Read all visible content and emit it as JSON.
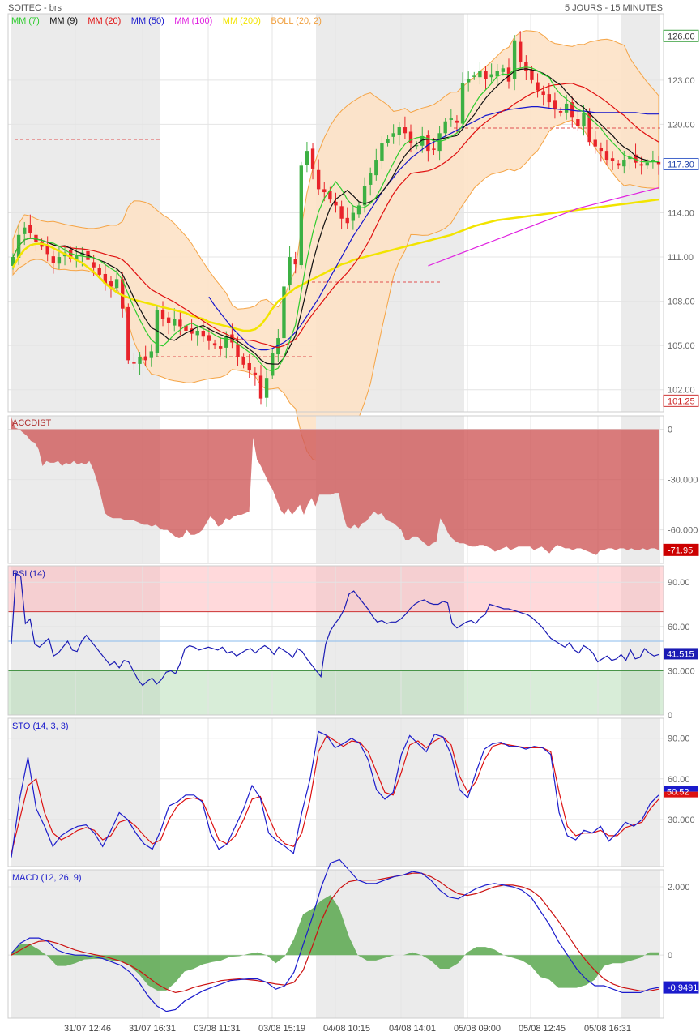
{
  "header": {
    "title": "SOITEC - brs",
    "period": "5 JOURS - 15 MINUTES"
  },
  "colors": {
    "shade": "#ebebeb",
    "grid": "#e4e4e4",
    "frame": "#cccccc",
    "up": "#3cb043",
    "down": "#e8232a",
    "boll_fill": "#fde2c6",
    "boll_line": "#f5a445",
    "accdist_fill": "#d05a5a",
    "rsi_line": "#1b1bb4",
    "stoK": "#1b1bcc",
    "stoD": "#dd1111",
    "macd_line": "#1b1bcc",
    "signal_line": "#cc1111",
    "hist_fill": "#5aa84f"
  },
  "chart_data": [
    {
      "panel": "price",
      "type": "candlestick",
      "legend": [
        {
          "label": "MM (7)",
          "color": "#2ecc2e"
        },
        {
          "label": "MM (9)",
          "color": "#111111"
        },
        {
          "label": "MM (20)",
          "color": "#e01010"
        },
        {
          "label": "MM (50)",
          "color": "#1515cc"
        },
        {
          "label": "MM (100)",
          "color": "#e020e0"
        },
        {
          "label": "MM (200)",
          "color": "#f2e400"
        },
        {
          "label": "BOLL (20, 2)",
          "color": "#f0a040"
        }
      ],
      "ylim": [
        100.5,
        127.5
      ],
      "yticks": [
        "126.00",
        "123.00",
        "120.00",
        "117.30",
        "114.00",
        "111.00",
        "108.00",
        "105.00",
        "102.00",
        "101.25"
      ],
      "ytick_values": [
        126,
        123,
        120,
        117.3,
        114,
        111,
        108,
        105,
        102,
        101.25
      ],
      "last_price": "117.30",
      "high_marker": "126.00",
      "low_marker": "101.25",
      "close": [
        111.0,
        112.5,
        113.0,
        112.6,
        112.0,
        111.7,
        111.2,
        110.6,
        111.0,
        111.3,
        110.9,
        111.1,
        111.3,
        110.8,
        110.3,
        109.8,
        109.2,
        109.0,
        109.5,
        107.5,
        104.0,
        103.8,
        104.2,
        104.0,
        104.6,
        107.4,
        106.8,
        106.5,
        106.8,
        106.3,
        106.0,
        105.8,
        106.0,
        105.6,
        105.3,
        105.0,
        104.8,
        105.6,
        105.2,
        104.2,
        103.7,
        103.3,
        103.0,
        101.4,
        102.8,
        104.5,
        105.5,
        109.0,
        111.0,
        110.5,
        117.2,
        118.2,
        117.0,
        115.6,
        115.4,
        114.9,
        114.5,
        113.6,
        113.3,
        114.0,
        114.5,
        115.8,
        116.7,
        117.6,
        118.7,
        119.0,
        119.4,
        119.8,
        119.4,
        118.7,
        118.6,
        119.2,
        118.2,
        118.3,
        119.4,
        120.2,
        120.4,
        120.1,
        122.8,
        123.1,
        123.3,
        123.6,
        123.1,
        123.4,
        123.6,
        123.8,
        122.9,
        125.7,
        124.2,
        123.6,
        123.0,
        122.3,
        122.0,
        121.5,
        121.0,
        120.8,
        121.4,
        120.5,
        119.9,
        120.8,
        118.8,
        118.5,
        118.2,
        117.6,
        117.5,
        117.2,
        117.6,
        117.8,
        117.4,
        117.2,
        117.4,
        117.6,
        117.3
      ],
      "ma200": [
        110.3,
        111.0,
        111.5,
        111.8,
        111.9,
        111.9,
        111.8,
        111.6,
        111.4,
        111.2,
        111.0,
        110.8,
        110.6,
        110.3,
        110.0,
        109.6,
        109.2,
        108.9,
        108.6,
        108.4,
        108.25,
        108.1,
        108.0,
        107.9,
        107.8,
        107.7,
        107.6,
        107.5,
        107.4,
        107.3,
        107.2,
        107.0,
        106.9,
        106.8,
        106.6,
        106.5,
        106.4,
        106.3,
        106.2,
        106.1,
        106.0,
        106.0,
        106.1,
        106.4,
        106.9,
        107.5,
        108.0,
        108.3,
        108.6,
        108.9,
        109.1,
        109.3,
        109.5,
        109.7,
        109.9,
        110.1,
        110.3,
        110.5,
        110.6,
        110.8,
        110.9,
        111.0,
        111.1,
        111.2,
        111.3,
        111.4,
        111.5,
        111.6,
        111.7,
        111.8,
        111.9,
        112.0,
        112.1,
        112.2,
        112.3,
        112.4,
        112.5,
        112.65,
        112.8,
        112.95,
        113.1,
        113.2,
        113.3,
        113.4,
        113.5,
        113.55,
        113.6,
        113.65,
        113.7,
        113.75,
        113.8,
        113.85,
        113.9,
        113.95,
        114.0,
        114.05,
        114.1,
        114.15,
        114.2,
        114.25,
        114.3,
        114.35,
        114.4,
        114.45,
        114.5,
        114.55,
        114.6,
        114.65,
        114.7,
        114.75,
        114.8,
        114.85,
        114.9
      ],
      "ma100_from": 72,
      "ma100": [
        110.4,
        110.55,
        110.7,
        110.85,
        111.0,
        111.15,
        111.3,
        111.45,
        111.6,
        111.75,
        111.9,
        112.05,
        112.2,
        112.35,
        112.5,
        112.65,
        112.8,
        112.95,
        113.1,
        113.25,
        113.4,
        113.55,
        113.7,
        113.85,
        114.0,
        114.15,
        114.3,
        114.4,
        114.5,
        114.6,
        114.7,
        114.8,
        114.9,
        115.0,
        115.1,
        115.2,
        115.3,
        115.4,
        115.5,
        115.6,
        115.7
      ],
      "ma50_from": 34,
      "ma50": [
        108.3,
        107.7,
        107.2,
        106.7,
        106.2,
        105.8,
        105.4,
        105.0,
        104.8,
        104.7,
        104.7,
        104.8,
        105.0,
        105.2,
        105.5,
        105.9,
        106.4,
        107.0,
        107.6,
        108.2,
        108.9,
        109.6,
        110.3,
        111.0,
        111.7,
        112.4,
        113.0,
        113.6,
        114.2,
        114.8,
        115.4,
        115.9,
        116.4,
        116.9,
        117.3,
        117.7,
        118.0,
        118.3,
        118.6,
        118.8,
        119.0,
        119.2,
        119.4,
        119.6,
        119.8,
        120.0,
        120.2,
        120.4,
        120.6,
        120.7,
        120.8,
        120.9,
        121.0,
        121.05,
        121.1,
        121.15,
        121.2,
        121.2,
        121.15,
        121.1,
        121.05,
        121.0,
        121.0,
        120.95,
        120.9,
        120.9,
        120.85,
        120.8,
        120.8,
        120.8,
        120.8,
        120.8,
        120.8,
        120.8,
        120.8,
        120.75,
        120.7,
        120.7,
        120.7
      ]
    },
    {
      "panel": "accdist",
      "type": "area",
      "label": "ACCDIST",
      "ylim": [
        -80,
        8
      ],
      "yticks": [
        "0",
        "-30.000",
        "-60.000",
        "-71.95"
      ],
      "ytick_values": [
        0,
        -30,
        -60,
        -71.95
      ],
      "last_value": "-71.95",
      "values": [
        7,
        1,
        0,
        -2,
        -4,
        -7,
        -8,
        -12,
        -22,
        -19,
        -20,
        -20,
        -19,
        -22,
        -20,
        -21,
        -19,
        -21,
        -20,
        -21,
        -19,
        -24,
        -31,
        -40,
        -50,
        -52,
        -53,
        -53,
        -53,
        -54,
        -54,
        -54,
        -55,
        -56,
        -57,
        -57,
        -58,
        -57,
        -59,
        -60,
        -60,
        -62,
        -64,
        -65,
        -64,
        -60,
        -63,
        -63,
        -62,
        -60,
        -56,
        -52,
        -54,
        -58,
        -57,
        -53,
        -54,
        -52,
        -51,
        -51,
        -50,
        -49,
        -5,
        -18,
        -22,
        -27,
        -32,
        -36,
        -42,
        -48,
        -51,
        -47,
        -51,
        -48,
        -45,
        -51,
        -45,
        -41,
        -46,
        -39,
        -39,
        -39,
        -39,
        -38,
        -38,
        -50,
        -58,
        -59,
        -57,
        -59,
        -56,
        -55,
        -52,
        -49,
        -51,
        -50,
        -54,
        -55,
        -56,
        -58,
        -60,
        -66,
        -66,
        -64,
        -64,
        -66,
        -68,
        -70,
        -68,
        -67,
        -53,
        -57,
        -62,
        -65,
        -67,
        -68,
        -68,
        -69,
        -70,
        -70,
        -69,
        -69,
        -70,
        -71,
        -73,
        -72,
        -71,
        -70,
        -72,
        -71,
        -70,
        -70,
        -70,
        -70,
        -72,
        -71,
        -70,
        -72,
        -74,
        -71,
        -69,
        -70,
        -71,
        -71,
        -72,
        -71,
        -71,
        -72,
        -73,
        -74,
        -75,
        -72,
        -72,
        -71,
        -71,
        -72,
        -71,
        -71,
        -72,
        -71,
        -72,
        -72,
        -71,
        -72,
        -71,
        -71,
        -72
      ]
    },
    {
      "panel": "rsi",
      "type": "line",
      "label": "RSI (14)",
      "ylim": [
        0,
        100
      ],
      "yticks": [
        "90.00",
        "60.00",
        "30.000",
        "0"
      ],
      "ytick_values": [
        90,
        60,
        30,
        0
      ],
      "overbought": 70,
      "oversold": 30,
      "midline": 50,
      "last_value": "41.515",
      "values": [
        48,
        96,
        94,
        62,
        65,
        48,
        46,
        49,
        52,
        40,
        42,
        46,
        50,
        44,
        43,
        50,
        54,
        50,
        46,
        42,
        38,
        34,
        36,
        32,
        37,
        36,
        30,
        24,
        20,
        23,
        25,
        21,
        24,
        29,
        30,
        28,
        35,
        45,
        47,
        46,
        44,
        45,
        46,
        45,
        44,
        46,
        42,
        43,
        40,
        42,
        44,
        45,
        42,
        45,
        47,
        45,
        41,
        46,
        44,
        42,
        39,
        45,
        43,
        38,
        34,
        30,
        26,
        48,
        57,
        62,
        66,
        72,
        82,
        84,
        80,
        76,
        72,
        67,
        63,
        64,
        62,
        63,
        63,
        65,
        68,
        72,
        75,
        77,
        78,
        76,
        75,
        75,
        77,
        76,
        62,
        59,
        61,
        63,
        64,
        62,
        66,
        68,
        75,
        74,
        73,
        72,
        72,
        71,
        70,
        69,
        68,
        66,
        63,
        60,
        56,
        52,
        50,
        48,
        46,
        49,
        44,
        42,
        47,
        45,
        42,
        36,
        38,
        40,
        37,
        38,
        41,
        37,
        44,
        38,
        39,
        45,
        42,
        40,
        41
      ]
    },
    {
      "panel": "sto",
      "type": "line",
      "label": "STO (14, 3, 3)",
      "ylim": [
        0,
        100
      ],
      "yticks": [
        "90.00",
        "60.00",
        "30.000"
      ],
      "ytick_values": [
        90,
        60,
        30
      ],
      "last_value": "50.52",
      "series": [
        {
          "name": "%K",
          "values": [
            2,
            45,
            76,
            38,
            25,
            10,
            18,
            22,
            25,
            26,
            20,
            10,
            22,
            35,
            30,
            20,
            12,
            8,
            22,
            40,
            43,
            48,
            48,
            43,
            20,
            8,
            12,
            25,
            38,
            55,
            46,
            20,
            14,
            10,
            5,
            35,
            60,
            95,
            92,
            83,
            86,
            90,
            86,
            74,
            52,
            45,
            50,
            78,
            92,
            86,
            80,
            93,
            91,
            78,
            52,
            46,
            65,
            82,
            86,
            87,
            84,
            84,
            82,
            84,
            83,
            78,
            35,
            18,
            15,
            22,
            20,
            25,
            14,
            20,
            28,
            25,
            30,
            42,
            48
          ]
        },
        {
          "name": "%D",
          "values": [
            5,
            30,
            55,
            60,
            35,
            20,
            15,
            18,
            22,
            24,
            22,
            15,
            18,
            28,
            30,
            25,
            18,
            12,
            15,
            30,
            40,
            45,
            46,
            44,
            30,
            15,
            12,
            18,
            30,
            45,
            47,
            32,
            18,
            12,
            10,
            20,
            45,
            80,
            92,
            88,
            84,
            88,
            87,
            80,
            65,
            50,
            48,
            65,
            85,
            88,
            83,
            88,
            91,
            85,
            62,
            50,
            58,
            74,
            84,
            86,
            85,
            84,
            83,
            83,
            83,
            80,
            50,
            25,
            18,
            20,
            20,
            22,
            18,
            18,
            24,
            26,
            28,
            38,
            45
          ]
        }
      ]
    },
    {
      "panel": "macd",
      "type": "line",
      "label": "MACD (12, 26, 9)",
      "ylim": [
        -1.85,
        2.5
      ],
      "yticks": [
        "2.000",
        "0",
        "-0.9491"
      ],
      "ytick_values": [
        2,
        0,
        -0.9491
      ],
      "last_value": "-0.9491",
      "series": [
        {
          "name": "MACD",
          "values": [
            0.05,
            0.35,
            0.5,
            0.5,
            0.4,
            0.15,
            0.05,
            0.0,
            0.0,
            -0.05,
            -0.1,
            -0.2,
            -0.3,
            -0.5,
            -0.8,
            -1.2,
            -1.5,
            -1.65,
            -1.6,
            -1.35,
            -1.2,
            -1.05,
            -0.95,
            -0.85,
            -0.75,
            -0.72,
            -0.7,
            -0.7,
            -0.8,
            -1.0,
            -0.9,
            -0.5,
            0.3,
            1.1,
            2.0,
            2.7,
            2.8,
            2.5,
            2.2,
            2.1,
            2.1,
            2.2,
            2.3,
            2.35,
            2.45,
            2.4,
            2.2,
            1.9,
            1.7,
            1.65,
            1.8,
            1.95,
            2.05,
            2.1,
            2.05,
            2.0,
            1.9,
            1.7,
            1.3,
            0.9,
            0.4,
            0.0,
            -0.4,
            -0.7,
            -0.9,
            -0.9,
            -1.0,
            -1.1,
            -1.1,
            -1.1,
            -1.0,
            -0.95
          ]
        },
        {
          "name": "Signal",
          "values": [
            0.0,
            0.15,
            0.3,
            0.4,
            0.42,
            0.35,
            0.25,
            0.15,
            0.08,
            0.02,
            -0.03,
            -0.1,
            -0.18,
            -0.3,
            -0.45,
            -0.65,
            -0.85,
            -1.0,
            -1.1,
            -1.05,
            -0.95,
            -0.88,
            -0.82,
            -0.75,
            -0.72,
            -0.7,
            -0.72,
            -0.75,
            -0.8,
            -0.85,
            -0.88,
            -0.8,
            -0.45,
            0.25,
            1.0,
            1.6,
            1.95,
            2.15,
            2.2,
            2.2,
            2.2,
            2.25,
            2.3,
            2.35,
            2.4,
            2.4,
            2.3,
            2.15,
            1.95,
            1.8,
            1.75,
            1.8,
            1.9,
            2.0,
            2.05,
            2.05,
            2.0,
            1.9,
            1.7,
            1.35,
            1.0,
            0.6,
            0.2,
            -0.15,
            -0.45,
            -0.7,
            -0.85,
            -0.95,
            -1.0,
            -1.05,
            -1.05,
            -1.0
          ]
        }
      ]
    }
  ],
  "xaxis": {
    "labels": [
      "31/07 12:46",
      "31/07 16:31",
      "03/08 11:31",
      "03/08 15:19",
      "04/08 10:15",
      "04/08 14:01",
      "05/08 09:00",
      "05/08 12:45",
      "05/08 16:31"
    ]
  }
}
